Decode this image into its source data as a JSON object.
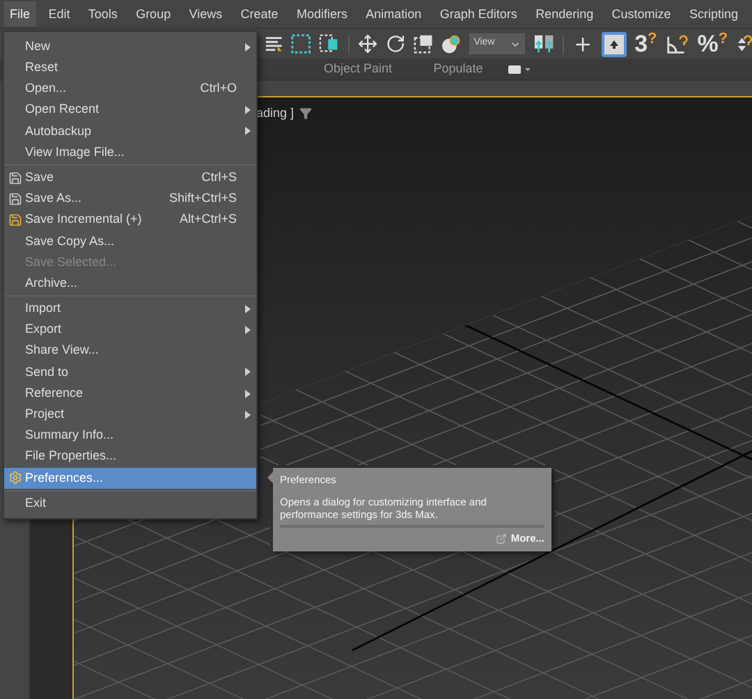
{
  "menu_bar": [
    {
      "label": "File",
      "selected": true
    },
    {
      "label": "Edit",
      "selected": false
    },
    {
      "label": "Tools",
      "selected": false
    },
    {
      "label": "Group",
      "selected": false
    },
    {
      "label": "Views",
      "selected": false
    },
    {
      "label": "Create",
      "selected": false
    },
    {
      "label": "Modifiers",
      "selected": false
    },
    {
      "label": "Animation",
      "selected": false
    },
    {
      "label": "Graph Editors",
      "selected": false
    },
    {
      "label": "Rendering",
      "selected": false
    },
    {
      "label": "Customize",
      "selected": false
    },
    {
      "label": "Scripting",
      "selected": false
    }
  ],
  "toolbar": {
    "view_dropdown": "View",
    "snap_glyphs": [
      {
        "glyph": "3",
        "mark": "?"
      },
      {
        "glyph": "%",
        "mark": "?"
      }
    ],
    "toggle_on": true
  },
  "ribbon_tabs": [
    "Object Paint",
    "Populate"
  ],
  "viewport": {
    "label": "ading ]"
  },
  "file_menu": [
    [
      {
        "label": "New",
        "submenu": true,
        "disabled": false,
        "selected": false
      },
      {
        "label": "Reset",
        "submenu": false,
        "disabled": false,
        "selected": false
      },
      {
        "label": "Open...",
        "shortcut": "Ctrl+O",
        "submenu": false,
        "disabled": false,
        "selected": false
      },
      {
        "label": "Open Recent",
        "submenu": true,
        "disabled": false,
        "selected": false
      },
      {
        "label": "Autobackup",
        "submenu": true,
        "disabled": false,
        "selected": false
      },
      {
        "label": "View Image File...",
        "submenu": false,
        "disabled": false,
        "selected": false
      }
    ],
    [
      {
        "label": "Save",
        "shortcut": "Ctrl+S",
        "submenu": false,
        "disabled": false,
        "selected": false
      },
      {
        "label": "Save As...",
        "shortcut": "Shift+Ctrl+S",
        "submenu": false,
        "disabled": false,
        "selected": false
      },
      {
        "label": "Save Incremental (+)",
        "shortcut": "Alt+Ctrl+S",
        "submenu": false,
        "disabled": false,
        "selected": false
      },
      {
        "label": "Save Copy As...",
        "submenu": false,
        "disabled": false,
        "selected": false
      },
      {
        "label": "Save Selected...",
        "submenu": false,
        "disabled": true,
        "selected": false
      },
      {
        "label": "Archive...",
        "submenu": false,
        "disabled": false,
        "selected": false
      }
    ],
    [
      {
        "label": "Import",
        "submenu": true,
        "disabled": false,
        "selected": false
      },
      {
        "label": "Export",
        "submenu": true,
        "disabled": false,
        "selected": false
      },
      {
        "label": "Share View...",
        "submenu": false,
        "disabled": false,
        "selected": false
      },
      {
        "label": "Send to",
        "submenu": true,
        "disabled": false,
        "selected": false
      },
      {
        "label": "Reference",
        "submenu": true,
        "disabled": false,
        "selected": false
      },
      {
        "label": "Project",
        "submenu": true,
        "disabled": false,
        "selected": false
      },
      {
        "label": "Summary Info...",
        "submenu": false,
        "disabled": false,
        "selected": false
      },
      {
        "label": "File Properties...",
        "submenu": false,
        "disabled": false,
        "selected": false
      },
      {
        "label": "Preferences...",
        "submenu": false,
        "disabled": false,
        "selected": true
      }
    ],
    [
      {
        "label": "Exit",
        "submenu": false,
        "disabled": false,
        "selected": false
      }
    ]
  ],
  "tooltip": {
    "title": "Preferences",
    "body": "Opens a dialog for customizing interface and performance settings for 3ds Max.",
    "link": "More..."
  }
}
